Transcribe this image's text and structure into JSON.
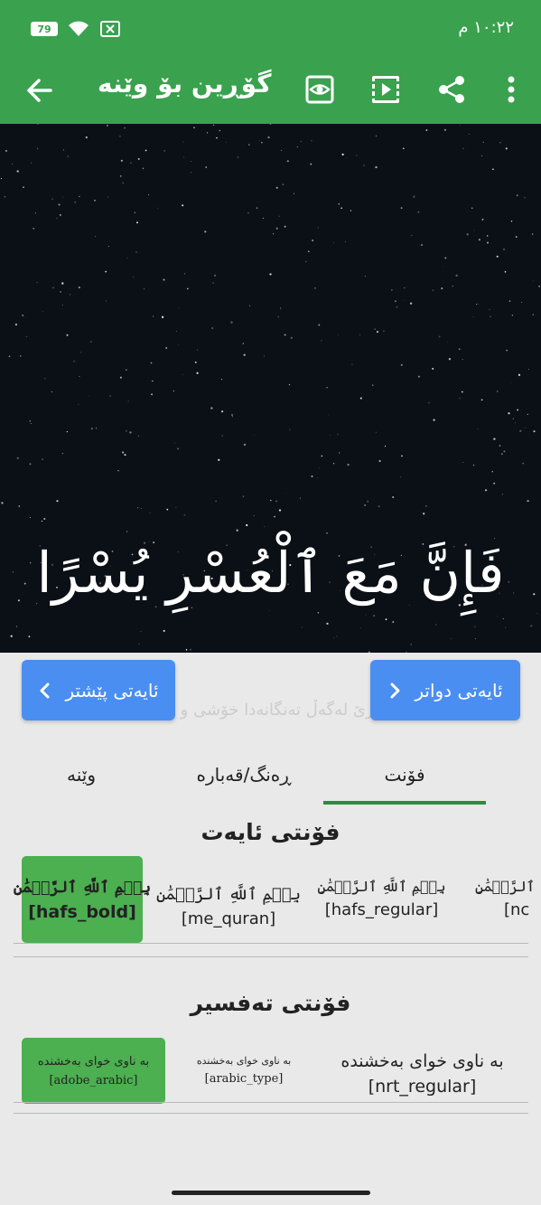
{
  "status": {
    "time": "١٠:٢٢ م",
    "battery": "79"
  },
  "appbar": {
    "title": "گۆڕین بۆ وێنە",
    "actions": [
      "back-arrow-icon",
      "preview-eye-icon",
      "video-icon",
      "share-icon",
      "more-vert-icon"
    ]
  },
  "stage": {
    "verse": "فَإِنَّ مَعَ ٱلْعُسْرِ يُسْرًا"
  },
  "nav": {
    "prev_label": "ئایەتی پێشتر",
    "next_label": "ئایەتی دواتر",
    "ghost_text": "بەراستی هاوڕێ لەگەڵ تەنگانەدا خۆشی و ئاسوودەیی دێت."
  },
  "tabs": {
    "font": "فۆنت",
    "color": "ڕەنگ/قەبارە",
    "image": "وێنە",
    "selected": "font"
  },
  "ayah_fonts": {
    "title": "فۆنتی ئایەت",
    "items": [
      {
        "sample": "بِسۡمِ ٱللَّهِ ٱلرَّحۡمَٰنِ",
        "name": "[hafs_bold]",
        "selected": true
      },
      {
        "sample": "بِسۡمِ ٱللَّهِ ٱلرَّحۡمَٰنِ",
        "name": "[me_quran]",
        "selected": false
      },
      {
        "sample": "بِسۡمِ ٱللَّهِ ٱلرَّحۡمَٰنِ",
        "name": "[hafs_regular]",
        "selected": false
      },
      {
        "sample": "ٱلرَّحۡمَٰنِ",
        "name": "[nc",
        "selected": false
      }
    ]
  },
  "tafsir_fonts": {
    "title": "فۆنتی تەفسیر",
    "items": [
      {
        "sample": "بە ناوی خوای بەخشندە",
        "name": "[adobe_arabic]",
        "selected": true
      },
      {
        "sample": "بە ناوی خوای بەخشندە",
        "name": "[arabic_type]",
        "selected": false
      },
      {
        "sample": "بە ناوی خوای بەخشندە",
        "name": "[nrt_regular]",
        "selected": false
      }
    ]
  },
  "colors": {
    "primary": "#3aa14e",
    "button": "#4a8ef2",
    "selected": "#4caf50"
  }
}
